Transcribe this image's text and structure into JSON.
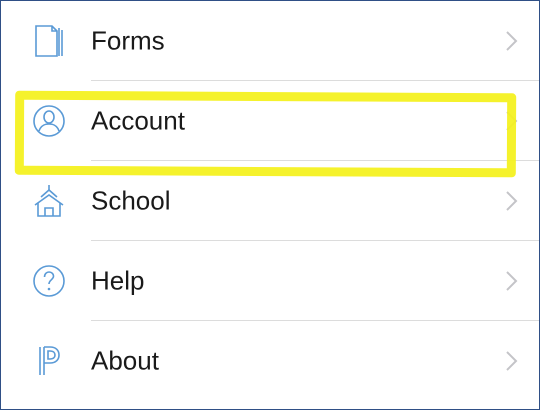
{
  "menu": {
    "items": [
      {
        "label": "Forms",
        "icon": "forms-icon"
      },
      {
        "label": "Account",
        "icon": "account-icon"
      },
      {
        "label": "School",
        "icon": "school-icon"
      },
      {
        "label": "Help",
        "icon": "help-icon"
      },
      {
        "label": "About",
        "icon": "about-logo-icon"
      }
    ]
  },
  "colors": {
    "icon": "#5a9ad6",
    "chevron": "#c4c4c8",
    "highlight": "#f4f11a",
    "frame_border": "#2f4f86",
    "divider": "#dcdcdc"
  }
}
